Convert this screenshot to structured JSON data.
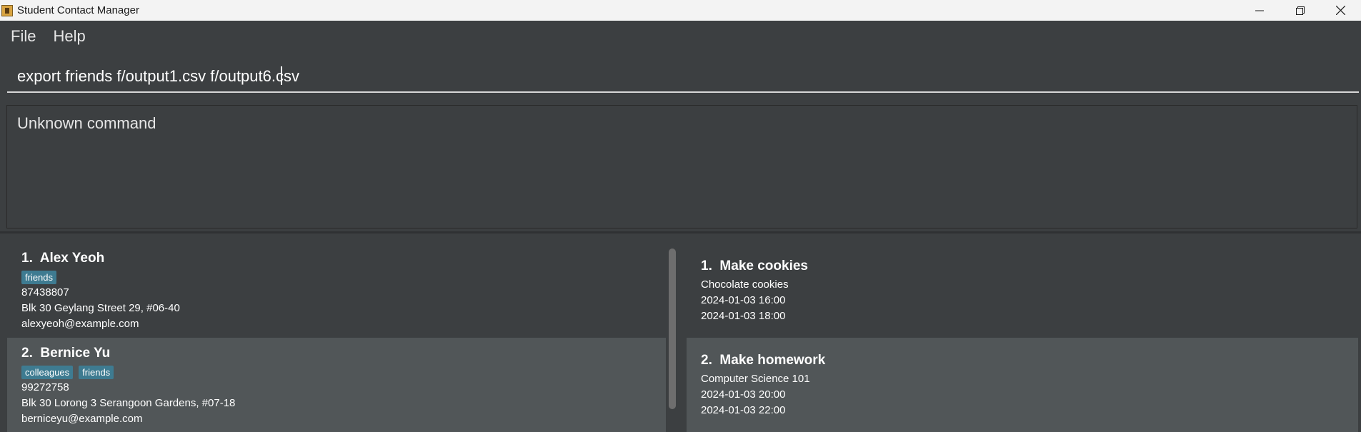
{
  "window": {
    "title": "Student Contact Manager",
    "icon": "app-icon",
    "controls": [
      "minimize-icon",
      "restore-icon",
      "close-icon"
    ]
  },
  "menu": {
    "file": "File",
    "help": "Help"
  },
  "command": {
    "value": "export friends f/output1.csv f/output6.csv"
  },
  "result": {
    "message": "Unknown command"
  },
  "persons": [
    {
      "index": "1.",
      "name": "Alex Yeoh",
      "tags": [
        "friends"
      ],
      "phone": "87438807",
      "address": "Blk 30 Geylang Street 29, #06-40",
      "email": "alexyeoh@example.com"
    },
    {
      "index": "2.",
      "name": "Bernice Yu",
      "tags": [
        "colleagues",
        "friends"
      ],
      "phone": "99272758",
      "address": "Blk 30 Lorong 3 Serangoon Gardens, #07-18",
      "email": "berniceyu@example.com"
    }
  ],
  "tasks": [
    {
      "index": "1.",
      "title": "Make cookies",
      "description": "Chocolate cookies",
      "start": "2024-01-03 16:00",
      "end": "2024-01-03 18:00"
    },
    {
      "index": "2.",
      "title": "Make homework",
      "description": "Computer Science 101",
      "start": "2024-01-03 20:00",
      "end": "2024-01-03 22:00"
    }
  ],
  "colors": {
    "background": "#3c3f41",
    "selected_card": "#515658",
    "tag": "#3e7b91"
  }
}
